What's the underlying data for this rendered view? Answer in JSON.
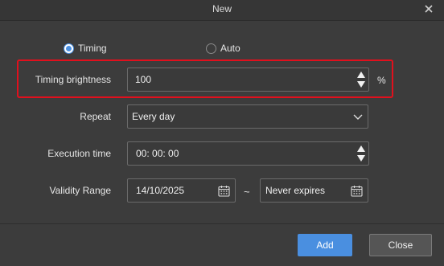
{
  "window": {
    "title": "New"
  },
  "mode": {
    "options": [
      {
        "label": "Timing",
        "checked": true
      },
      {
        "label": "Auto",
        "checked": false
      }
    ]
  },
  "brightness": {
    "label": "Timing brightness",
    "value": "100",
    "unit": "%"
  },
  "repeat": {
    "label": "Repeat",
    "value": "Every day"
  },
  "execution": {
    "label": "Execution time",
    "value": "00: 00: 00"
  },
  "validity": {
    "label": "Validity Range",
    "start": "14/10/2025",
    "separator": "~",
    "end": "Never expires"
  },
  "buttons": {
    "add": "Add",
    "close": "Close"
  },
  "colors": {
    "accent": "#4a8fe0",
    "highlight": "#e0101d",
    "background": "#3c3c3c"
  }
}
